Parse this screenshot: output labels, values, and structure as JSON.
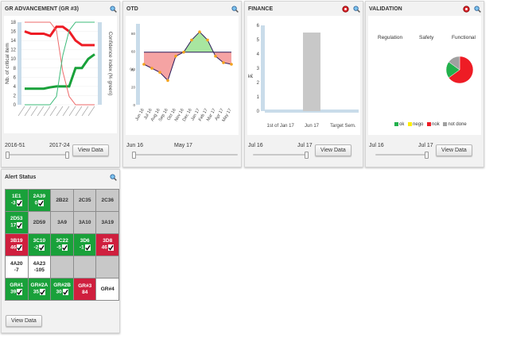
{
  "panels": {
    "gr": {
      "title": "GR ADVANCEMENT (GR #3)",
      "ylabel": "Nb. of critical item",
      "y2label": "Confidence index (% green)",
      "yticks": [
        "18",
        "16",
        "14",
        "12",
        "10",
        "8",
        "6",
        "4",
        "2",
        "0"
      ],
      "range_start": "2016-51",
      "range_end": "2017-24",
      "button": "View Data"
    },
    "otd": {
      "title": "OTD",
      "ylabel": "%",
      "yticks": [
        "80",
        "60",
        "40",
        "20",
        "0"
      ],
      "xticks": [
        "Jun 16",
        "Jul 16",
        "Aug 16",
        "Sep 16",
        "Oct 16",
        "Nov 16",
        "Dec 16",
        "Jan 17",
        "Feb 17",
        "Mar 17",
        "Apr 17",
        "May 17"
      ],
      "range_start": "Jun 16",
      "range_end": "May 17"
    },
    "finance": {
      "title": "FINANCE",
      "ylabel": "k€",
      "yticks": [
        "6",
        "5",
        "4",
        "3",
        "2",
        "1",
        "0"
      ],
      "xticks": [
        "1st of Jan 17",
        "Jun 17",
        "Target Sem."
      ],
      "range_start": "Jul 16",
      "range_end": "Jul 17",
      "button": "View Data"
    },
    "validation": {
      "title": "VALIDATION",
      "columns": [
        "Regulation",
        "Safety",
        "Functional"
      ],
      "legend": [
        "ok",
        "nego",
        "nok",
        "not done"
      ],
      "range_start": "Jul 16",
      "range_end": "Jul 17",
      "button": "View Data"
    },
    "alert": {
      "title": "Alert Status",
      "button": "View Data"
    }
  },
  "colors": {
    "green": "#19a13a",
    "red": "#cf1f3e",
    "grey": "#c8c8c8",
    "yellow": "#ffee00",
    "pie_nok": "#ee1c25",
    "pie_ok": "#22b14c",
    "pie_nodone": "#a0a0a0"
  },
  "chart_data": [
    {
      "type": "line",
      "chart": "gr",
      "ylim": [
        0,
        18
      ],
      "y2lim": [
        0,
        100
      ],
      "series": [
        {
          "values": [
            16,
            15.5,
            15.5,
            15.5,
            15,
            17,
            17,
            16,
            14,
            13,
            13,
            13
          ]
        },
        {
          "values": [
            3.5,
            3.5,
            3.5,
            3.5,
            3.8,
            4,
            4,
            4,
            8,
            8,
            10,
            11
          ]
        },
        {
          "values": [
            100,
            100,
            100,
            100,
            100,
            90,
            40,
            10,
            0,
            0,
            0,
            0
          ]
        },
        {
          "values": [
            0,
            0,
            0,
            0,
            0,
            10,
            60,
            90,
            100,
            100,
            100,
            100
          ]
        }
      ]
    },
    {
      "type": "area",
      "chart": "otd",
      "x": [
        "Jun 16",
        "Jul 16",
        "Aug 16",
        "Sep 16",
        "Oct 16",
        "Nov 16",
        "Dec 16",
        "Jan 17",
        "Feb 17",
        "Mar 17",
        "Apr 17",
        "May 17"
      ],
      "values": [
        50,
        45,
        40,
        30,
        60,
        65,
        80,
        90,
        80,
        60,
        52,
        50
      ],
      "target": 65,
      "ylim": [
        0,
        100
      ]
    },
    {
      "type": "bar",
      "chart": "finance",
      "categories": [
        "1st of Jan 17",
        "Jun 17",
        "Target Sem."
      ],
      "values": [
        0,
        5.5,
        0
      ],
      "ylim": [
        0,
        6
      ]
    },
    {
      "type": "pie",
      "chart": "validation",
      "labels": [
        "nok",
        "ok",
        "not done"
      ],
      "values": [
        65,
        20,
        15
      ]
    }
  ],
  "alerts": {
    "rows": [
      [
        {
          "l1": "1E1",
          "l2": "-3",
          "c": "green",
          "chk": true
        },
        {
          "l1": "2A39",
          "l2": "0",
          "c": "green",
          "chk": true
        },
        {
          "l1": "2B22",
          "l2": "",
          "c": "grey",
          "chk": false
        },
        {
          "l1": "2C35",
          "l2": "",
          "c": "grey",
          "chk": false
        },
        {
          "l1": "2C36",
          "l2": "",
          "c": "grey",
          "chk": false
        }
      ],
      [
        {
          "l1": "2D53",
          "l2": "17",
          "c": "green",
          "chk": true
        },
        {
          "l1": "2D59",
          "l2": "",
          "c": "grey",
          "chk": false
        },
        {
          "l1": "3A9",
          "l2": "",
          "c": "grey",
          "chk": false
        },
        {
          "l1": "3A10",
          "l2": "",
          "c": "grey",
          "chk": false
        },
        {
          "l1": "3A19",
          "l2": "",
          "c": "grey",
          "chk": false
        }
      ],
      [
        {
          "l1": "3B19",
          "l2": "46",
          "c": "red",
          "chk": true
        },
        {
          "l1": "3C10",
          "l2": "-2",
          "c": "green",
          "chk": true
        },
        {
          "l1": "3C22",
          "l2": "-5",
          "c": "green",
          "chk": true
        },
        {
          "l1": "3D6",
          "l2": "-1",
          "c": "green",
          "chk": true
        },
        {
          "l1": "3D8",
          "l2": "46",
          "c": "red",
          "chk": true
        }
      ],
      [
        {
          "l1": "4A20",
          "l2": "-7",
          "c": "white",
          "chk": false
        },
        {
          "l1": "4A23",
          "l2": "-105",
          "c": "white",
          "chk": false
        },
        {
          "l1": "",
          "l2": "",
          "c": "empty",
          "chk": false
        },
        {
          "l1": "",
          "l2": "",
          "c": "empty",
          "chk": false
        },
        {
          "l1": "",
          "l2": "",
          "c": "empty",
          "chk": false
        }
      ],
      [
        {
          "l1": "GR#1",
          "l2": "39",
          "c": "green",
          "chk": true
        },
        {
          "l1": "GR#2A",
          "l2": "35",
          "c": "green",
          "chk": true
        },
        {
          "l1": "GR#2B",
          "l2": "30",
          "c": "green",
          "chk": true
        },
        {
          "l1": "GR#3",
          "l2": "84",
          "c": "red",
          "chk": false
        },
        {
          "l1": "GR#4",
          "l2": "",
          "c": "white",
          "chk": false
        }
      ]
    ]
  }
}
